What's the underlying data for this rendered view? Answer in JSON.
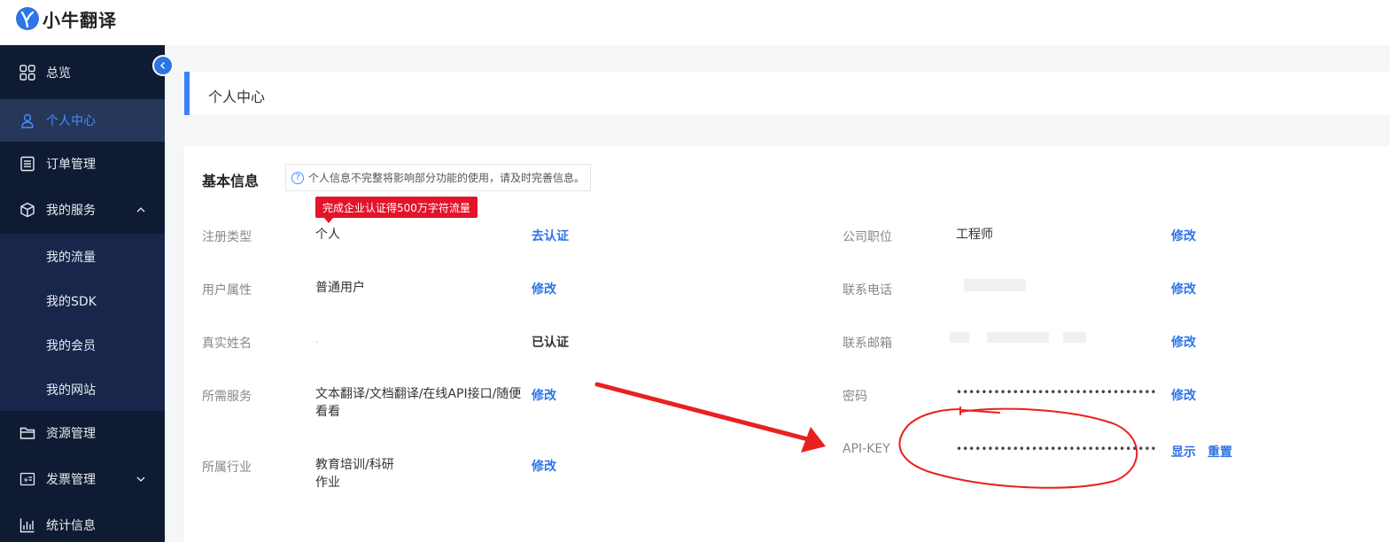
{
  "brand": {
    "name": "小牛翻译"
  },
  "sidebar": {
    "items": [
      {
        "label": "总览",
        "icon": "grid-icon"
      },
      {
        "label": "个人中心",
        "icon": "user-icon"
      },
      {
        "label": "订单管理",
        "icon": "list-icon"
      },
      {
        "label": "我的服务",
        "icon": "box-icon"
      },
      {
        "label": "资源管理",
        "icon": "folder-icon"
      },
      {
        "label": "发票管理",
        "icon": "invoice-icon"
      },
      {
        "label": "统计信息",
        "icon": "chart-icon"
      }
    ],
    "submenu": [
      "我的流量",
      "我的SDK",
      "我的会员",
      "我的网站"
    ]
  },
  "page": {
    "title": "个人中心"
  },
  "basic_info": {
    "section_title": "基本信息",
    "notice": "个人信息不完整将影响部分功能的使用，请及时完善信息。",
    "promo": "完成企业认证得500万字符流量",
    "left": [
      {
        "label": "注册类型",
        "value": "个人",
        "action": "去认证"
      },
      {
        "label": "用户属性",
        "value": "普通用户",
        "action": "修改"
      },
      {
        "label": "真实姓名",
        "value": ".",
        "action": "已认证"
      },
      {
        "label": "所需服务",
        "value": "文本翻译/文档翻译/在线API接口/随便看看",
        "action": "修改"
      },
      {
        "label": "所属行业",
        "value": "教育培训/科研作业",
        "action": "修改"
      }
    ],
    "right": [
      {
        "label": "公司职位",
        "value": "工程师",
        "action": "修改"
      },
      {
        "label": "联系电话",
        "value": "",
        "action": "修改"
      },
      {
        "label": "联系邮箱",
        "value": "",
        "action": "修改"
      },
      {
        "label": "密码",
        "value": "••••••••••••••••••••••••••••••••",
        "action": "修改"
      },
      {
        "label": "API-KEY",
        "value": "••••••••••••••••••••••••••••••••",
        "action": "显示",
        "action2": "重置"
      }
    ]
  },
  "colors": {
    "accent": "#2d74e6",
    "sidebar_bg": "#0f1b32",
    "promo": "#e3132a",
    "annotation": "#e8211f"
  }
}
